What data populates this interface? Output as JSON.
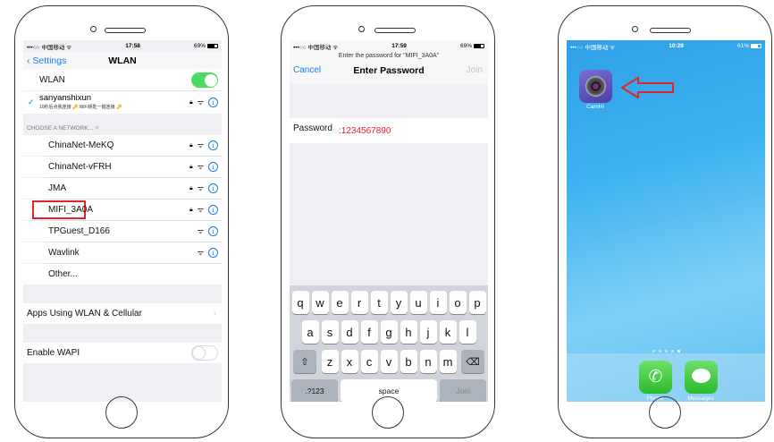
{
  "phone1": {
    "status": {
      "carrier": "•••○○ 中国移动 ᯤ",
      "time": "17:58",
      "battery": "69%"
    },
    "nav": {
      "back": "Settings",
      "title": "WLAN"
    },
    "wlan_label": "WLAN",
    "connected": {
      "name": "sanyanshixun",
      "sub": "10秒后点我连接 🔑 WiFi钥匙一键连接 🔑"
    },
    "choose_header": "CHOOSE A NETWORK...",
    "networks": [
      {
        "name": "ChinaNet-MeKQ"
      },
      {
        "name": "ChinaNet-vFRH"
      },
      {
        "name": "JMA"
      },
      {
        "name": "MIFI_3A0A"
      },
      {
        "name": "TPGuest_D166"
      },
      {
        "name": "Wavlink"
      },
      {
        "name": "Other..."
      }
    ],
    "apps_using": "Apps Using WLAN & Cellular",
    "enable_wapi": "Enable WAPI"
  },
  "phone2": {
    "status": {
      "carrier": "•••○○ 中国移动 ᯤ",
      "time": "17:59",
      "battery": "69%"
    },
    "prompt": "Enter the password for \"MIFI_3A0A\"",
    "cancel": "Cancel",
    "title": "Enter Password",
    "join": "Join",
    "password_label": "Password",
    "password_value": ":1234567890",
    "keys": {
      "row1": [
        "q",
        "w",
        "e",
        "r",
        "t",
        "y",
        "u",
        "i",
        "o",
        "p"
      ],
      "row2": [
        "a",
        "s",
        "d",
        "f",
        "g",
        "h",
        "j",
        "k",
        "l"
      ],
      "row3": [
        "z",
        "x",
        "c",
        "v",
        "b",
        "n",
        "m"
      ],
      "shift": "⇧",
      "delete": "⌫",
      "num": ".?123",
      "space": "space",
      "join": "Join"
    }
  },
  "phone3": {
    "status": {
      "carrier": "•••○○ 中国移动 ᯤ",
      "time": "10:28",
      "battery": "61%"
    },
    "camhi_label": "CamHi",
    "phone_label": "Phone",
    "messages_label": "Messages"
  },
  "colors": {
    "ios_blue": "#1a7cf5",
    "highlight_red": "#e2232a",
    "toggle_green": "#4cd964"
  }
}
